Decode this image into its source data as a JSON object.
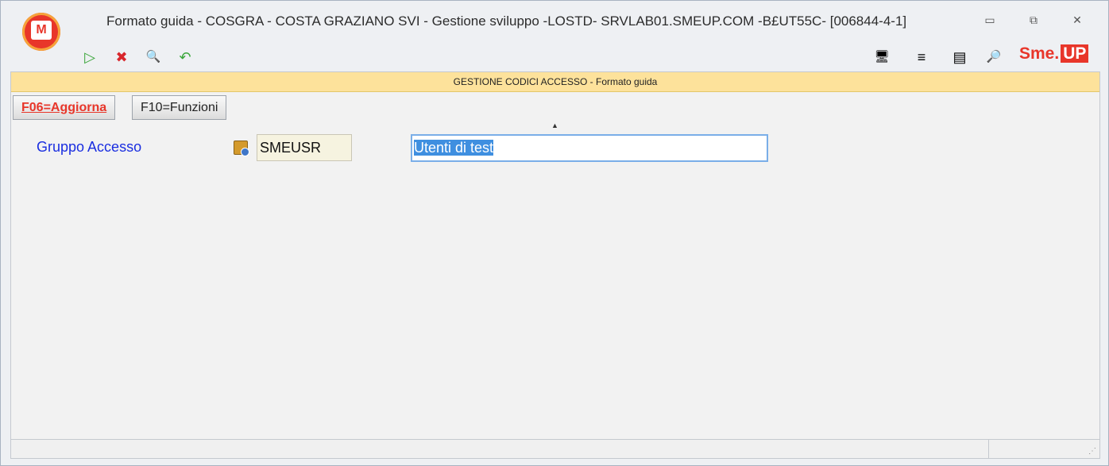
{
  "window": {
    "title": "Formato guida - COSGRA - COSTA GRAZIANO SVI - Gestione sviluppo -LOSTD- SRVLAB01.SMEUP.COM -B£UT55C- [006844-4-1]",
    "app_icon_text": "M",
    "minimize": "▭",
    "restore": "⧉",
    "close": "✕"
  },
  "toolbar": {
    "left_icons": [
      {
        "name": "run-icon",
        "glyph": "▷",
        "color": "#3aa63a"
      },
      {
        "name": "cancel-icon",
        "glyph": "✖",
        "color": "#d8262b"
      },
      {
        "name": "zoom-icon",
        "glyph": "🔍",
        "color": "#3468b0"
      },
      {
        "name": "undo-icon",
        "glyph": "↶",
        "color": "#3aa63a"
      }
    ],
    "right_icons": [
      {
        "name": "monitor-icon",
        "glyph": "🖥"
      },
      {
        "name": "list-icon",
        "glyph": "≡"
      },
      {
        "name": "documents-icon",
        "glyph": "▤"
      },
      {
        "name": "magnifier-icon",
        "glyph": "🔎"
      }
    ],
    "logo_text": "Sme.",
    "logo_highlight": "UP"
  },
  "panel": {
    "header": "GESTIONE CODICI ACCESSO -  Formato guida",
    "function_keys": [
      {
        "label": "F06=Aggiorna"
      },
      {
        "label": "F10=Funzioni"
      }
    ],
    "sort_caret": "▲",
    "field": {
      "label": "Gruppo Accesso",
      "code": "SMEUSR",
      "description": "Utenti di test"
    }
  },
  "colors": {
    "accent": "#e8362a",
    "header_bar": "#fde29b",
    "label_blue": "#1a2ee0",
    "selection": "#3f8fe0"
  }
}
